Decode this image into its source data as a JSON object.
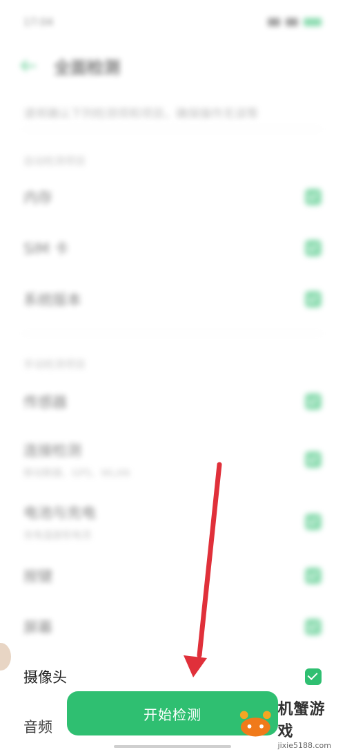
{
  "status_bar": {
    "time": "17:04",
    "extra": "■"
  },
  "header": {
    "title": "全面检测"
  },
  "description": "请将确认下列检测项和项目，确保操作无误等",
  "sections": [
    {
      "label": "自动检测项目",
      "items": [
        {
          "label": "内存",
          "sub": ""
        },
        {
          "label": "SIM 卡",
          "sub": ""
        },
        {
          "label": "系统版本",
          "sub": ""
        }
      ]
    },
    {
      "label": "手动检测项目",
      "items": [
        {
          "label": "传感器",
          "sub": ""
        },
        {
          "label": "连接检测",
          "sub": "移动数据、GPS、WLAN"
        },
        {
          "label": "电池与充电",
          "sub": "充电温度和电流"
        },
        {
          "label": "按键",
          "sub": ""
        },
        {
          "label": "屏幕",
          "sub": ""
        }
      ]
    }
  ],
  "camera_row": {
    "label": "摄像头"
  },
  "audio_row": {
    "label": "音频"
  },
  "start_button": {
    "label": "开始检测"
  },
  "watermark": {
    "main": "机蟹游戏",
    "url": "jixie5188.com"
  },
  "colors": {
    "accent": "#2fbf71",
    "arrow": "#e0303a"
  }
}
